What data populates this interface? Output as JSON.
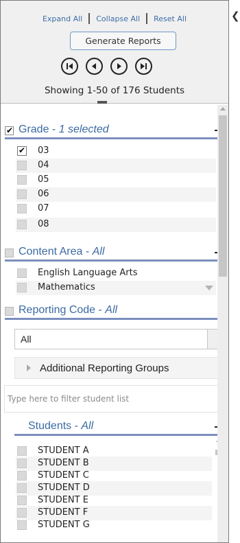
{
  "header": {
    "expand_all": "Expand All",
    "collapse_all": "Collapse All",
    "reset_all": "Reset All",
    "generate_reports": "Generate Reports",
    "showing": "Showing 1-50 of 176 Students"
  },
  "grade": {
    "title": "Grade - ",
    "status": "1 selected",
    "items": [
      "03",
      "04",
      "05",
      "06",
      "07",
      "08"
    ]
  },
  "content_area": {
    "title": "Content Area - ",
    "status": "All",
    "items": [
      "English Language Arts",
      "Mathematics"
    ]
  },
  "reporting_code": {
    "title": "Reporting Code - ",
    "status": "All",
    "selected": "All"
  },
  "groups": {
    "label": "Additional Reporting Groups"
  },
  "filter": {
    "placeholder": "Type here to filter student list"
  },
  "students": {
    "title": "Students - ",
    "status": "All",
    "items": [
      "STUDENT A",
      "STUDENT B",
      "STUDENT C",
      "STUDENT D",
      "STUDENT E",
      "STUDENT F",
      "STUDENT G"
    ]
  },
  "colors": {
    "accent": "#3b6aa2",
    "link": "#3c6ea6",
    "rule": "#7b8fbd"
  }
}
